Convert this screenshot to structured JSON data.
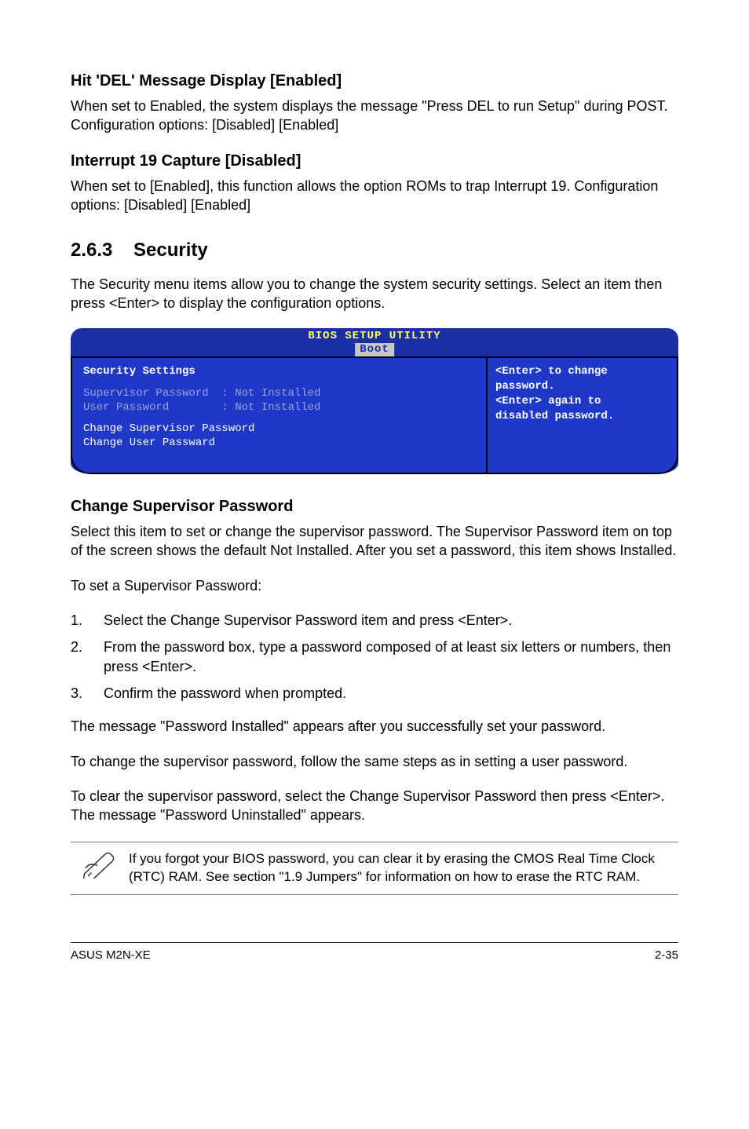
{
  "section1": {
    "heading": "Hit 'DEL' Message Display [Enabled]",
    "body": "When set to Enabled, the system displays the message \"Press DEL to run Setup\" during POST. Configuration options: [Disabled] [Enabled]"
  },
  "section2": {
    "heading": "Interrupt 19 Capture [Disabled]",
    "body": "When set to [Enabled], this function allows the option ROMs to trap Interrupt 19. Configuration options: [Disabled] [Enabled]"
  },
  "section3": {
    "number": "2.6.3",
    "title": "Security",
    "intro": "The Security menu items allow you to change the system security settings. Select an item then press <Enter> to display the configuration options."
  },
  "bios": {
    "title": "BIOS SETUP UTILITY",
    "tab": "Boot",
    "left": {
      "header": "Security Settings",
      "rows": [
        {
          "label": "Supervisor Password",
          "value": ": Not Installed",
          "style": "dim"
        },
        {
          "label": "User Password",
          "value": ": Not Installed",
          "style": "dim"
        }
      ],
      "actions": [
        {
          "text": "Change Supervisor Password",
          "style": "sel"
        },
        {
          "text": "Change User Passward",
          "style": "hl"
        }
      ]
    },
    "right": {
      "lines": [
        "<Enter> to change",
        "password.",
        "<Enter> again to",
        "disabled password."
      ]
    }
  },
  "section4": {
    "heading": "Change Supervisor Password",
    "p1": "Select this item to set or change the supervisor password. The Supervisor Password item on top of the screen shows the default Not Installed. After you set a password, this item shows Installed.",
    "p2": "To set a Supervisor Password:",
    "steps": [
      "Select the Change Supervisor Password item and press <Enter>.",
      "From the password box, type a password composed of at least six letters or numbers, then press <Enter>.",
      "Confirm the password when prompted."
    ],
    "p3": "The message \"Password Installed\" appears after you successfully set your password.",
    "p4": "To change the supervisor password, follow the same steps as in setting a user password.",
    "p5": "To clear the supervisor password, select the Change Supervisor Password then press <Enter>. The message \"Password Uninstalled\" appears."
  },
  "note": {
    "text": "If you forgot your BIOS password, you can clear it by erasing the CMOS Real Time Clock (RTC) RAM. See section \"1.9  Jumpers\" for information on how to erase the RTC RAM."
  },
  "footer": {
    "left": "ASUS M2N-XE",
    "right": "2-35"
  }
}
